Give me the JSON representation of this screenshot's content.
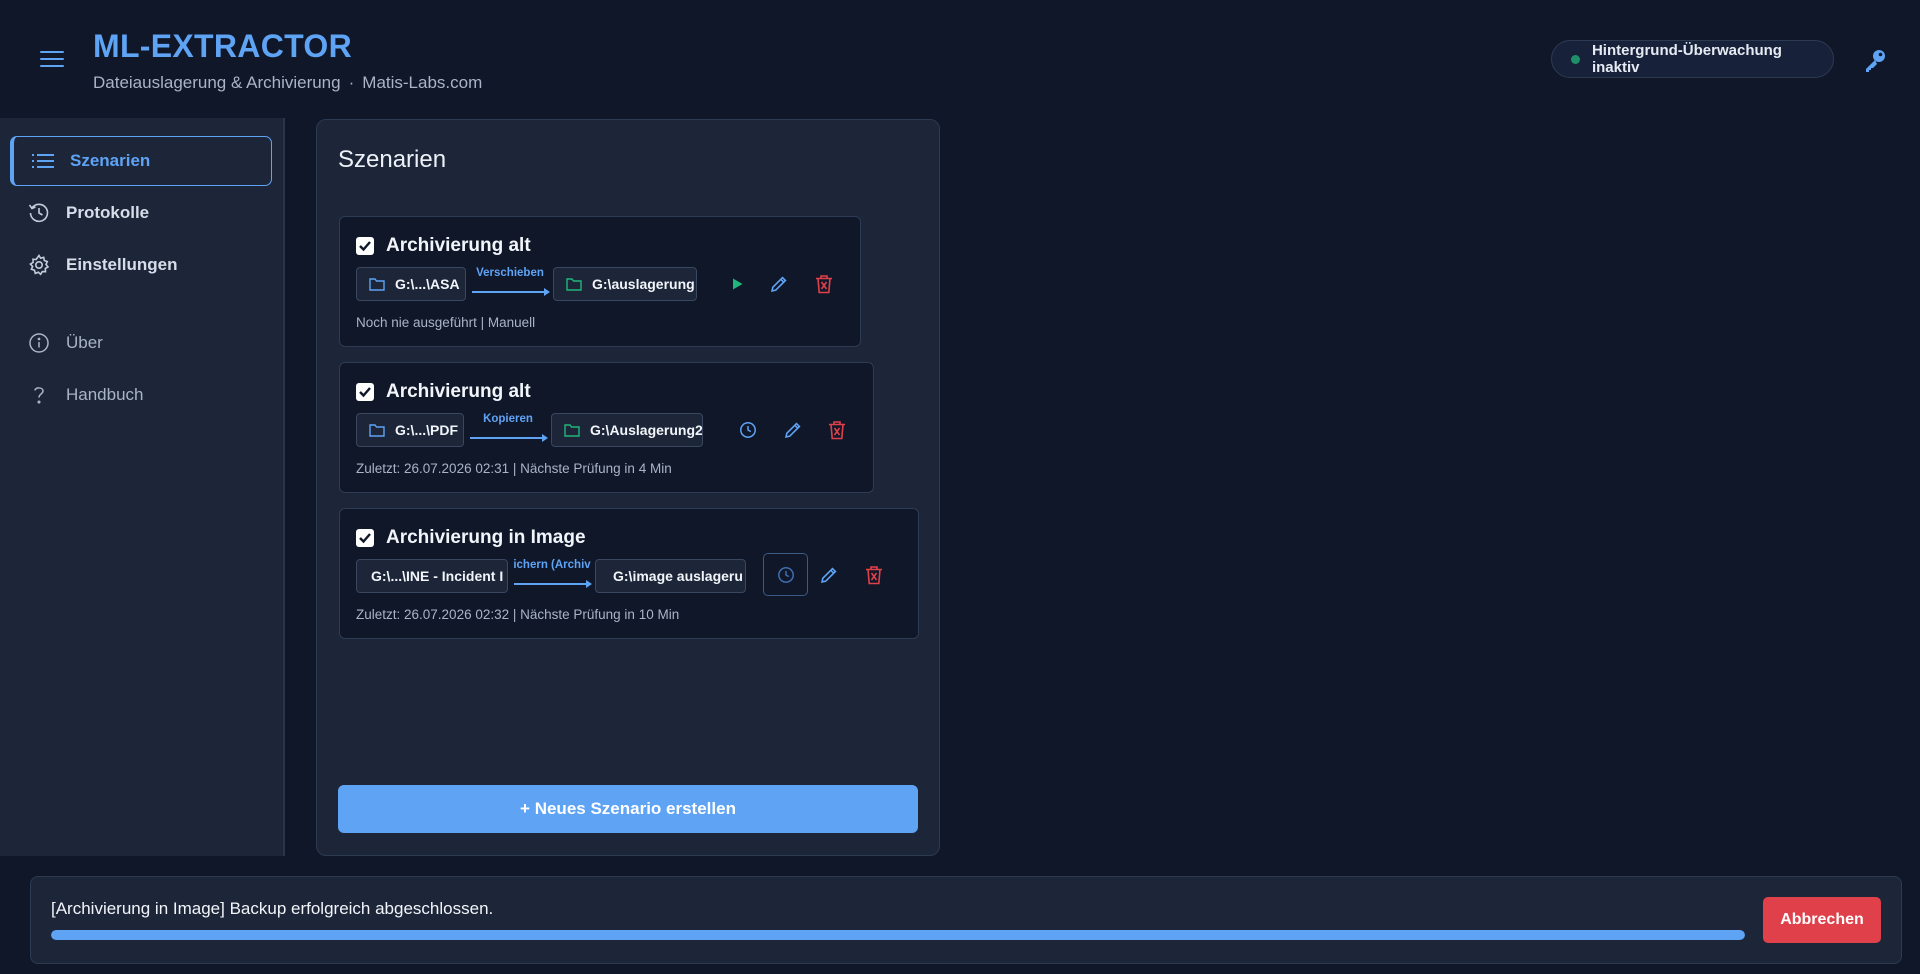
{
  "app": {
    "title": "ML-EXTRACTOR",
    "subtitle": "Dateiauslagerung & Archivierung",
    "separator": "·",
    "site": "Matis-Labs.com",
    "status": "Hintergrund-Überwachung inaktiv",
    "accent": "#5fa3f5"
  },
  "sidebar": {
    "items": [
      {
        "label": "Szenarien",
        "icon": "list-icon"
      },
      {
        "label": "Protokolle",
        "icon": "history-icon"
      },
      {
        "label": "Einstellungen",
        "icon": "gear-icon"
      },
      {
        "label": "Über",
        "icon": "info-icon"
      },
      {
        "label": "Handbuch",
        "icon": "help-icon"
      }
    ]
  },
  "main": {
    "title": "Szenarien",
    "scenarios": [
      {
        "name": "Archivierung alt",
        "checked": true,
        "source": "G:\\...\\ASA",
        "action": "Verschieben",
        "target": "G:\\auslagerung",
        "meta": "Noch nie ausgeführt | Manuell"
      },
      {
        "name": "Archivierung alt",
        "checked": true,
        "source": "G:\\...\\PDF",
        "action": "Kopieren",
        "target": "G:\\Auslagerung2",
        "meta": "Zuletzt: 26.07.2026 02:31 | Nächste Prüfung in 4 Min"
      },
      {
        "name": "Archivierung in Image",
        "checked": true,
        "source": "G:\\...\\INE - Incident I",
        "action": "ichern (Archiv",
        "target": "G:\\image auslageru",
        "meta": "Zuletzt: 26.07.2026 02:32 | Nächste Prüfung in 10 Min"
      }
    ],
    "new_button": "+ Neues Szenario erstellen"
  },
  "progress": {
    "message": "[Archivierung in Image] Backup erfolgreich abgeschlossen.",
    "percent": 100,
    "cancel_label": "Abbrechen"
  },
  "colors": {
    "background": "#0f1729",
    "panel": "#1c2638",
    "play": "#21b67a",
    "delete": "#e0404a",
    "folder_target": "#21b67a"
  }
}
